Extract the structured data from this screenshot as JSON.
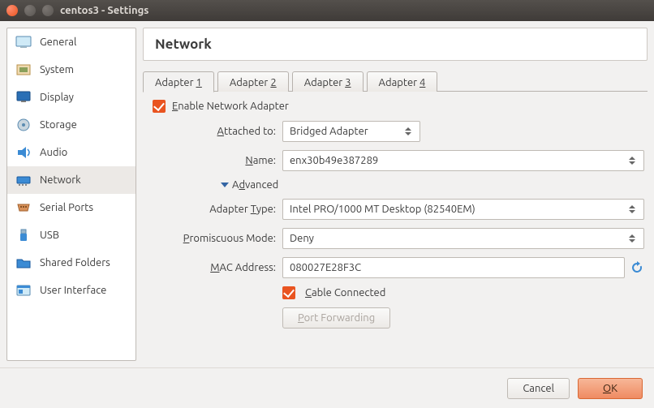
{
  "window": {
    "title": "centos3 - Settings"
  },
  "sidebar": {
    "items": [
      {
        "label": "General"
      },
      {
        "label": "System"
      },
      {
        "label": "Display"
      },
      {
        "label": "Storage"
      },
      {
        "label": "Audio"
      },
      {
        "label": "Network"
      },
      {
        "label": "Serial Ports"
      },
      {
        "label": "USB"
      },
      {
        "label": "Shared Folders"
      },
      {
        "label": "User Interface"
      }
    ]
  },
  "panel": {
    "title": "Network"
  },
  "tabs": [
    {
      "label": "Adapter 1"
    },
    {
      "label": "Adapter 2"
    },
    {
      "label": "Adapter 3"
    },
    {
      "label": "Adapter 4"
    }
  ],
  "form": {
    "enable_label": "Enable Network Adapter",
    "attached_label": "Attached to:",
    "attached_value": "Bridged Adapter",
    "name_label": "Name:",
    "name_value": "enx30b49e387289",
    "advanced_label": "Advanced",
    "adapter_type_label": "Adapter Type:",
    "adapter_type_value": "Intel PRO/1000 MT Desktop (82540EM)",
    "promiscuous_label": "Promiscuous Mode:",
    "promiscuous_value": "Deny",
    "mac_label": "MAC Address:",
    "mac_value": "080027E28F3C",
    "cable_label": "Cable Connected",
    "port_fwd_label": "Port Forwarding"
  },
  "footer": {
    "cancel": "Cancel",
    "ok": "OK"
  }
}
